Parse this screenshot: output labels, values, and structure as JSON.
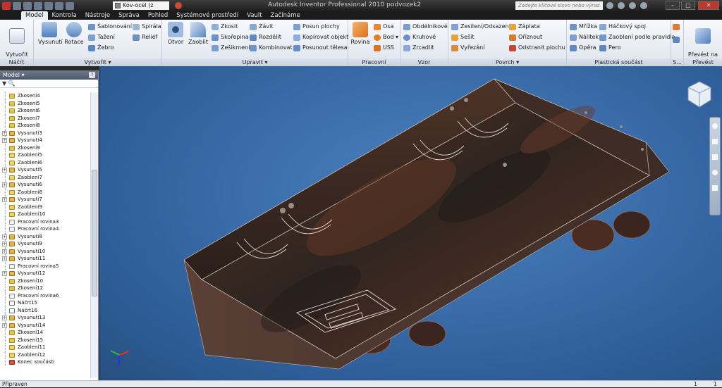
{
  "titlebar": {
    "material": "Kov-ocel (z",
    "title": "Autodesk Inventor Professional 2010    podvozek2",
    "search_placeholder": "Zadejte klíčové slovo nebo výraz."
  },
  "menu": [
    "Model",
    "Kontrola",
    "Nástroje",
    "Správa",
    "Pohled",
    "Systémové prostředí",
    "Vault",
    "Začínáme"
  ],
  "ribbon": {
    "nacrt": {
      "label": "Náčrt",
      "create_2d_sketch": "Vytvořit\n2D náčrt"
    },
    "vytvorit": {
      "label": "Vytvořit ▾",
      "vysunuti": "Vysunutí",
      "rotace": "Rotace",
      "sablonovani": "Šablonování",
      "tazeni": "Tažení",
      "zebro": "Žebro",
      "spirala": "Spirála",
      "relief": "Reliéf"
    },
    "upravit": {
      "label": "Upravit ▾",
      "otvor": "Otvor",
      "zaoblit": "Zaoblit",
      "zkosit": "Zkosit",
      "skorepina": "Skořepina",
      "zeslimeni": "Zešikmení",
      "zavit": "Závit",
      "rozdelit": "Rozdělit",
      "kombinovat": "Kombinovat",
      "posun_plochy": "Posun plochy",
      "kopirovat_objekt": "Kopírovat objekt",
      "posunout_telesa": "Posunout tělesa"
    },
    "pracovni": {
      "label": "Pracovní konstruk...",
      "rovina": "Rovina",
      "osa": "Osa",
      "bod": "Bod ▾",
      "uss": "USS"
    },
    "vzor": {
      "label": "Vzor",
      "obdelnikove": "Obdélníkové",
      "kruhove": "Kruhové",
      "zrcadlit": "Zrcadlit"
    },
    "povrch": {
      "label": "Povrch ▾",
      "zesileni": "Zesílení/Odsazení",
      "sesit": "Sešít",
      "vyrezani": "Vyřezání",
      "zaplata": "Záplata",
      "oriznout": "Oříznout",
      "odstranit_plochu": "Odstranit plochu"
    },
    "plasticka": {
      "label": "Plastická součást",
      "mrizka": "Mřížka",
      "natik": "Nálitek",
      "opera": "Opěra",
      "hackovy_spoj": "Háčkový spoj",
      "zaobleni_pravidla": "Zaoblení podle pravidla",
      "pero": "Pero"
    },
    "s": {
      "label": "S..."
    },
    "prevest": {
      "label": "Převést",
      "prevest_na_plech": "Převést na\nplech"
    }
  },
  "browser": {
    "title": "Model ▾",
    "help": "?",
    "tools": "▼  🔍",
    "items": [
      {
        "label": "Zkosení4",
        "type": "chamfer",
        "exp": ""
      },
      {
        "label": "Zkosení5",
        "type": "chamfer",
        "exp": ""
      },
      {
        "label": "Zkosení6",
        "type": "chamfer",
        "exp": ""
      },
      {
        "label": "Zkosení7",
        "type": "chamfer",
        "exp": ""
      },
      {
        "label": "Zkosení8",
        "type": "chamfer",
        "exp": ""
      },
      {
        "label": "Vysunutí3",
        "type": "extrude",
        "exp": "+"
      },
      {
        "label": "Vysunutí4",
        "type": "extrude",
        "exp": "+"
      },
      {
        "label": "Zkosení9",
        "type": "chamfer",
        "exp": ""
      },
      {
        "label": "Zaoblení5",
        "type": "fillet",
        "exp": ""
      },
      {
        "label": "Zaoblení6",
        "type": "fillet",
        "exp": ""
      },
      {
        "label": "Vysunutí5",
        "type": "extrude",
        "exp": "+"
      },
      {
        "label": "Zaoblení7",
        "type": "fillet",
        "exp": ""
      },
      {
        "label": "Vysunutí6",
        "type": "extrude",
        "exp": "+"
      },
      {
        "label": "Zaoblení8",
        "type": "fillet",
        "exp": ""
      },
      {
        "label": "Vysunutí7",
        "type": "extrude",
        "exp": "+"
      },
      {
        "label": "Zaoblení9",
        "type": "fillet",
        "exp": ""
      },
      {
        "label": "Zaoblení10",
        "type": "fillet",
        "exp": ""
      },
      {
        "label": "Pracovní rovina3",
        "type": "plane",
        "exp": ""
      },
      {
        "label": "Pracovní rovina4",
        "type": "plane",
        "exp": ""
      },
      {
        "label": "Vysunutí8",
        "type": "extrude",
        "exp": "+"
      },
      {
        "label": "Vysunutí9",
        "type": "extrude",
        "exp": "+"
      },
      {
        "label": "Vysunutí10",
        "type": "extrude",
        "exp": "+"
      },
      {
        "label": "Vysunutí11",
        "type": "extrude",
        "exp": "+"
      },
      {
        "label": "Pracovní rovina5",
        "type": "plane",
        "exp": ""
      },
      {
        "label": "Vysunutí12",
        "type": "extrude",
        "exp": "+"
      },
      {
        "label": "Zkosení10",
        "type": "chamfer",
        "exp": ""
      },
      {
        "label": "Zkosení12",
        "type": "chamfer",
        "exp": ""
      },
      {
        "label": "Pracovní rovina6",
        "type": "plane",
        "exp": ""
      },
      {
        "label": "Náčrt15",
        "type": "sketch",
        "exp": ""
      },
      {
        "label": "Náčrt16",
        "type": "sketch",
        "exp": ""
      },
      {
        "label": "Vysunutí13",
        "type": "extrude",
        "exp": "+"
      },
      {
        "label": "Vysunutí14",
        "type": "extrude",
        "exp": "+"
      },
      {
        "label": "Zkosení14",
        "type": "chamfer",
        "exp": ""
      },
      {
        "label": "Zkosení15",
        "type": "chamfer",
        "exp": ""
      },
      {
        "label": "Zaoblení11",
        "type": "fillet",
        "exp": ""
      },
      {
        "label": "Zaoblení12",
        "type": "fillet",
        "exp": ""
      },
      {
        "label": "Konec součásti",
        "type": "end",
        "exp": ""
      }
    ]
  },
  "status": {
    "text": "Připraven",
    "n1": "1",
    "n2": "1"
  },
  "colors": {
    "viewport_bg": "#3d74b3",
    "model_dark": "#3a2a22",
    "model_rust": "#6b3a26"
  }
}
